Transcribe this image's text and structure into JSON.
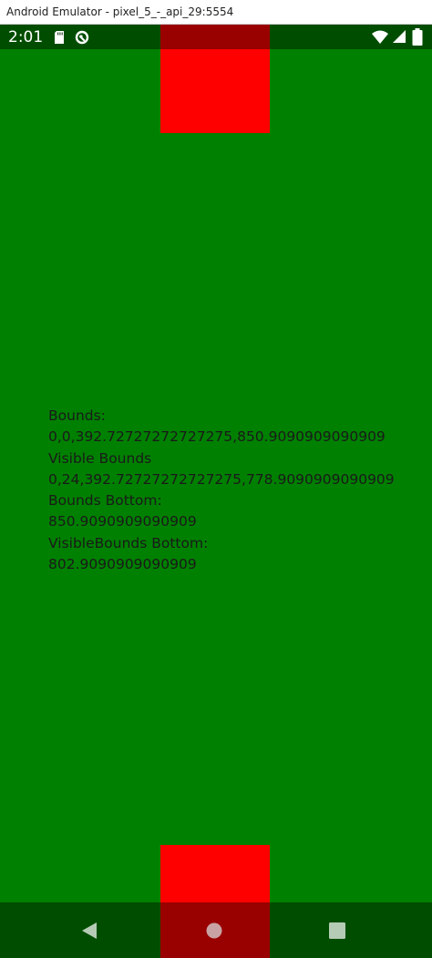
{
  "window": {
    "title": "Android Emulator - pixel_5_-_api_29:5554"
  },
  "statusbar": {
    "time": "2:01",
    "icons": [
      "sd-card-icon",
      "sync-icon",
      "wifi-icon",
      "signal-icon",
      "battery-icon"
    ]
  },
  "content": {
    "lines": [
      "Bounds:",
      "0,0,392.72727272727275,850.9090909090909",
      "Visible Bounds",
      "0,24,392.72727272727275,778.9090909090909",
      "Bounds Bottom:",
      "850.9090909090909",
      "VisibleBounds Bottom:",
      "802.9090909090909"
    ]
  },
  "navbar": {
    "buttons": [
      "back-icon",
      "home-icon",
      "recents-icon"
    ]
  },
  "colors": {
    "background": "#008000",
    "block": "#ff0000",
    "bar_overlay": "rgba(0,0,0,0.4)",
    "text": "#1a1a1a"
  }
}
